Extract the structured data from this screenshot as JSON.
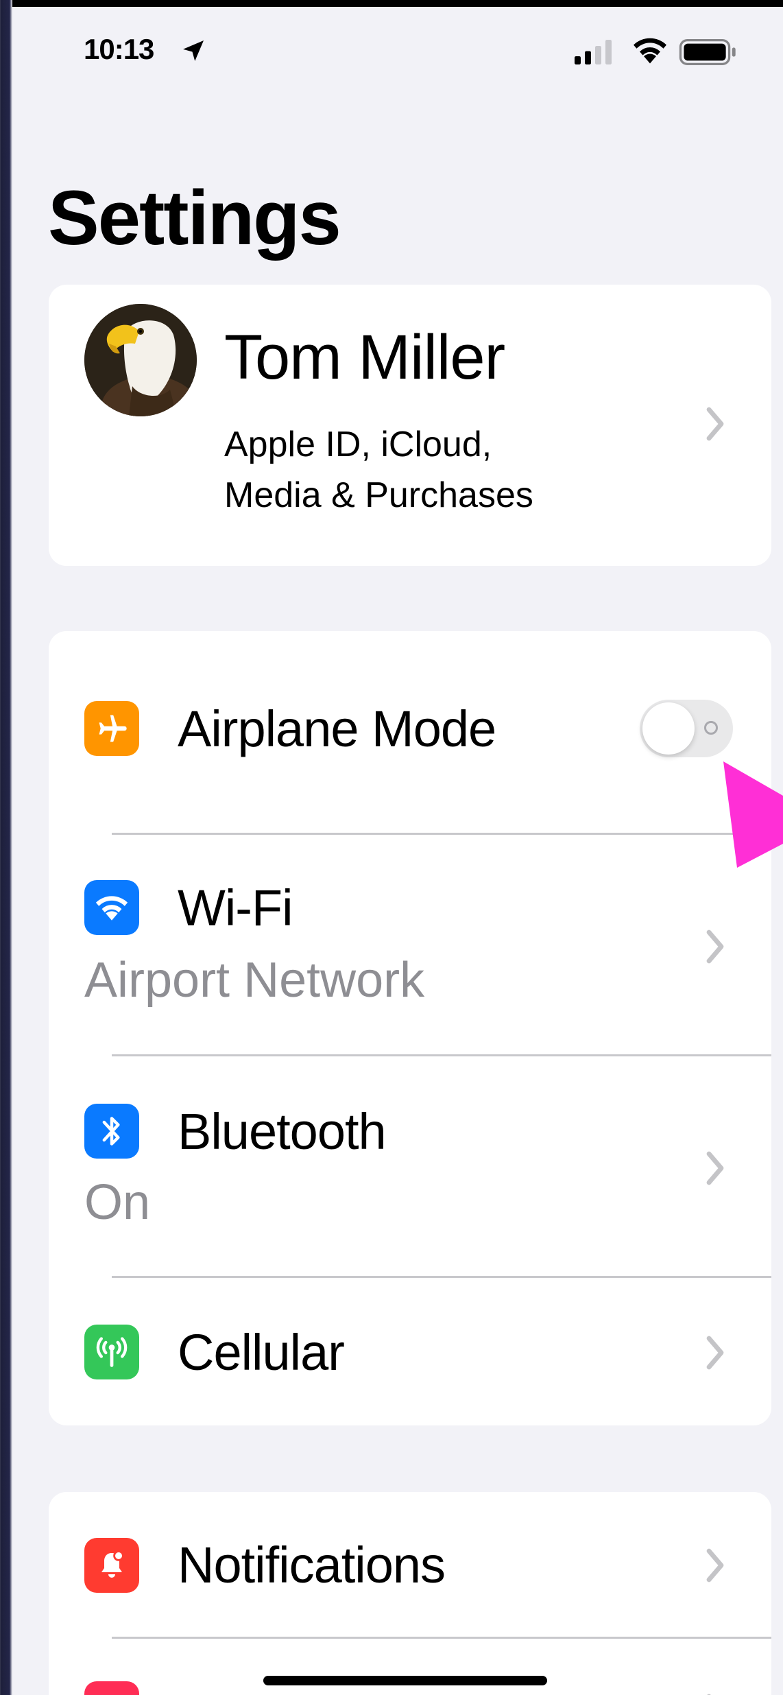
{
  "status_bar": {
    "time": "10:13",
    "icons": [
      "location-arrow-icon",
      "cellular-signal-icon",
      "wifi-icon",
      "battery-icon"
    ]
  },
  "page_title": "Settings",
  "profile": {
    "name": "Tom Miller",
    "subtitle_line1": "Apple ID, iCloud,",
    "subtitle_line2": "Media & Purchases",
    "avatar": "bald-eagle-photo"
  },
  "connectivity": {
    "airplane": {
      "label": "Airplane Mode",
      "icon": "airplane-icon",
      "icon_color": "#ff9500",
      "toggle_on": false
    },
    "wifi": {
      "label": "Wi-Fi",
      "value": "Airport Network",
      "icon": "wifi-icon",
      "icon_color": "#0a7aff"
    },
    "bluetooth": {
      "label": "Bluetooth",
      "value": "On",
      "icon": "bluetooth-icon",
      "icon_color": "#0a7aff"
    },
    "cellular": {
      "label": "Cellular",
      "icon": "cellular-antenna-icon",
      "icon_color": "#34c759"
    }
  },
  "notifications_group": {
    "notifications": {
      "label": "Notifications",
      "icon": "bell-icon",
      "icon_color": "#ff3b30"
    },
    "sounds": {
      "icon": "speaker-icon",
      "icon_color": "#ff2d55"
    }
  },
  "accent_colors": {
    "pointer": "#ff2fd6",
    "chevron": "#c4c4c7",
    "secondary_text": "#8e8e93"
  }
}
